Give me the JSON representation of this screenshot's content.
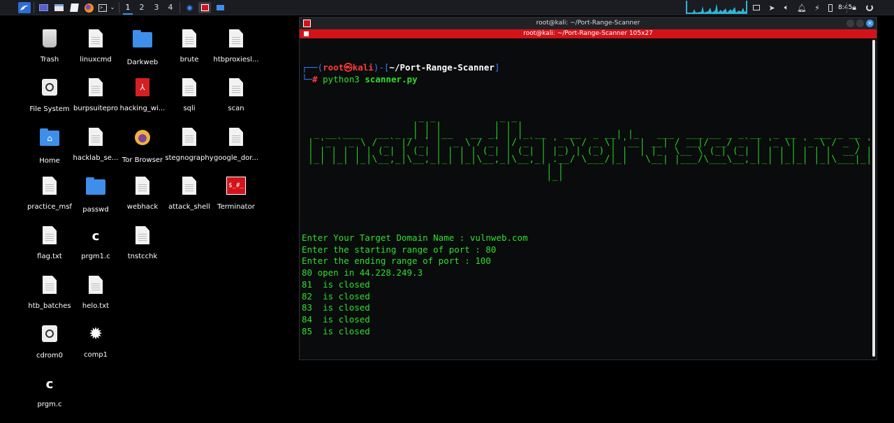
{
  "panel": {
    "workspaces": [
      "1",
      "2",
      "3",
      "4"
    ],
    "clock": "8:45"
  },
  "desktop": {
    "icons": [
      {
        "label": "Trash",
        "kind": "trash"
      },
      {
        "label": "linuxcmd",
        "kind": "doc"
      },
      {
        "label": "Darkweb",
        "kind": "folder"
      },
      {
        "label": "brute",
        "kind": "doc"
      },
      {
        "label": "htbproxiesl...",
        "kind": "doc"
      },
      {
        "label": "File System",
        "kind": "drive"
      },
      {
        "label": "burpsuitepro",
        "kind": "doc"
      },
      {
        "label": "hacking_wi...",
        "kind": "pdf"
      },
      {
        "label": "sqli",
        "kind": "doc"
      },
      {
        "label": "scan",
        "kind": "doc"
      },
      {
        "label": "Home",
        "kind": "home"
      },
      {
        "label": "hacklab_se...",
        "kind": "doc"
      },
      {
        "label": "Tor Browser",
        "kind": "tor"
      },
      {
        "label": "stegnography",
        "kind": "doc"
      },
      {
        "label": "google_dor...",
        "kind": "doc"
      },
      {
        "label": "practice_msf",
        "kind": "doc"
      },
      {
        "label": "passwd",
        "kind": "folder"
      },
      {
        "label": "webhack",
        "kind": "doc"
      },
      {
        "label": "attack_shell",
        "kind": "doc"
      },
      {
        "label": "Terminator",
        "kind": "terminator"
      },
      {
        "label": "flag.txt",
        "kind": "doc"
      },
      {
        "label": "prgm1.c",
        "kind": "c"
      },
      {
        "label": "tnstcchk",
        "kind": "doc"
      },
      {
        "label": "htb_batches",
        "kind": "doc"
      },
      {
        "label": "helo.txt",
        "kind": "doc"
      },
      {
        "label": "cdrom0",
        "kind": "drive"
      },
      {
        "label": "comp1",
        "kind": "gear"
      },
      {
        "label": "prgm.c",
        "kind": "c"
      }
    ]
  },
  "terminal": {
    "window_title": "root@kali: ~/Port-Range-Scanner",
    "tab_title": "root@kali: ~/Port-Range-Scanner 105x27",
    "prompt": {
      "user": "root",
      "at_symbol": "㉿",
      "host": "kali",
      "path": "~/Port-Range-Scanner",
      "symbol": "#",
      "command": "python3",
      "argument": "scanner.py"
    },
    "banner": [
      "                   _ _           _ _",
      "                  | | |         | | |",
      " _ __ ___   __ _ _| | |__   __ _| | |_ __   ___  _ __| |_   ___  ___ __ _ _ __  _ __   ___ _ __",
      "| '_ ` _ \\ / _` |/ _` |  _ \\ / _` |/ _` | '_ \\ / _ \\| '__| __| / __|/ __/ _` | '_ \\| '_ \\ / _ \\ '__|",
      "| | | | | | (_| | (_| | | | | (_| | (_| | |_) | (_) | |  | |_  \\__ \\ (_| (_| | | | | | | |  __/ |",
      "|_| |_| |_|\\__,_|\\__,_|_| |_|\\__,_|\\__,_| .__/ \\___/|_|   \\__| |___/\\___\\__,_|_| |_|_| |_|\\___|_|",
      "                                         | |",
      "                                         |_|"
    ],
    "output": [
      "Enter Your Target Domain Name : vulnweb.com",
      "Enter the starting range of port : 80",
      "Enter the ending range of port : 100",
      "80 open in 44.228.249.3",
      "81  is closed",
      "82  is closed",
      "83  is closed",
      "84  is closed",
      "85  is closed"
    ]
  },
  "colors": {
    "terminal_green": "#2be02b",
    "prompt_blue": "#3b7bff",
    "prompt_red": "#ff3b3b",
    "tab_red": "#d3131a",
    "panel_bg": "#1a1c21",
    "cpu_accent": "#2fb5d8"
  }
}
